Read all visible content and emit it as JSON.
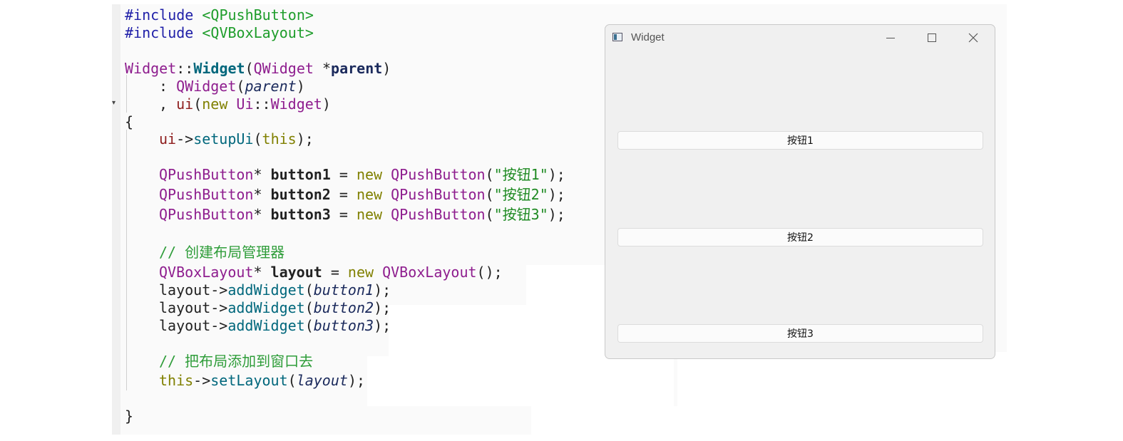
{
  "code": {
    "line1": {
      "dir": "#include",
      "hdr": "<QPushButton>"
    },
    "line2": {
      "dir": "#include",
      "hdr": "<QVBoxLayout>"
    },
    "line4": {
      "cls": "Widget",
      "sep": "::",
      "ctor": "Widget",
      "open": "(",
      "ptype": "QWidget",
      "star": " *",
      "pname": "parent",
      "close": ")"
    },
    "line5": {
      "colon": ": ",
      "base": "QWidget",
      "open": "(",
      "arg": "parent",
      "close": ")"
    },
    "line6": {
      "comma": ", ",
      "mem": "ui",
      "open": "(",
      "kw": "new",
      "sp": " ",
      "ns": "Ui",
      "sep": "::",
      "cls": "Widget",
      "close": ")"
    },
    "line7": "{",
    "line8": {
      "mem": "ui",
      "arrow": "->",
      "fn": "setupUi",
      "open": "(",
      "kw": "this",
      "close": ");"
    },
    "line10": {
      "type": "QPushButton",
      "star": "* ",
      "var": "button1",
      "eq": " = ",
      "kw": "new",
      "sp": " ",
      "ctor": "QPushButton",
      "args": "(",
      "str": "\"按钮1\"",
      "end": ");"
    },
    "line11": {
      "type": "QPushButton",
      "star": "* ",
      "var": "button2",
      "eq": " = ",
      "kw": "new",
      "sp": " ",
      "ctor": "QPushButton",
      "args": "(",
      "str": "\"按钮2\"",
      "end": ");"
    },
    "line12": {
      "type": "QPushButton",
      "star": "* ",
      "var": "button3",
      "eq": " = ",
      "kw": "new",
      "sp": " ",
      "ctor": "QPushButton",
      "args": "(",
      "str": "\"按钮3\"",
      "end": ");"
    },
    "line14": "// 创建布局管理器",
    "line15": {
      "type": "QVBoxLayout",
      "star": "* ",
      "var": "layout",
      "eq": " = ",
      "kw": "new",
      "sp": " ",
      "ctor": "QVBoxLayout",
      "end": "();"
    },
    "line16": {
      "obj": "layout",
      "arrow": "->",
      "fn": "addWidget",
      "open": "(",
      "arg": "button1",
      "close": ");"
    },
    "line17": {
      "obj": "layout",
      "arrow": "->",
      "fn": "addWidget",
      "open": "(",
      "arg": "button2",
      "close": ");"
    },
    "line18": {
      "obj": "layout",
      "arrow": "->",
      "fn": "addWidget",
      "open": "(",
      "arg": "button3",
      "close": ");"
    },
    "line20": "// 把布局添加到窗口去",
    "line21": {
      "kw": "this",
      "arrow": "->",
      "fn": "setLayout",
      "open": "(",
      "arg": "layout",
      "close": ");"
    },
    "line23": "}"
  },
  "window": {
    "title": "Widget",
    "buttons": [
      "按钮1",
      "按钮2",
      "按钮3"
    ]
  },
  "icons": {
    "app": "qt-app-icon",
    "minimize": "minimize-icon",
    "maximize": "maximize-icon",
    "close": "close-icon"
  }
}
